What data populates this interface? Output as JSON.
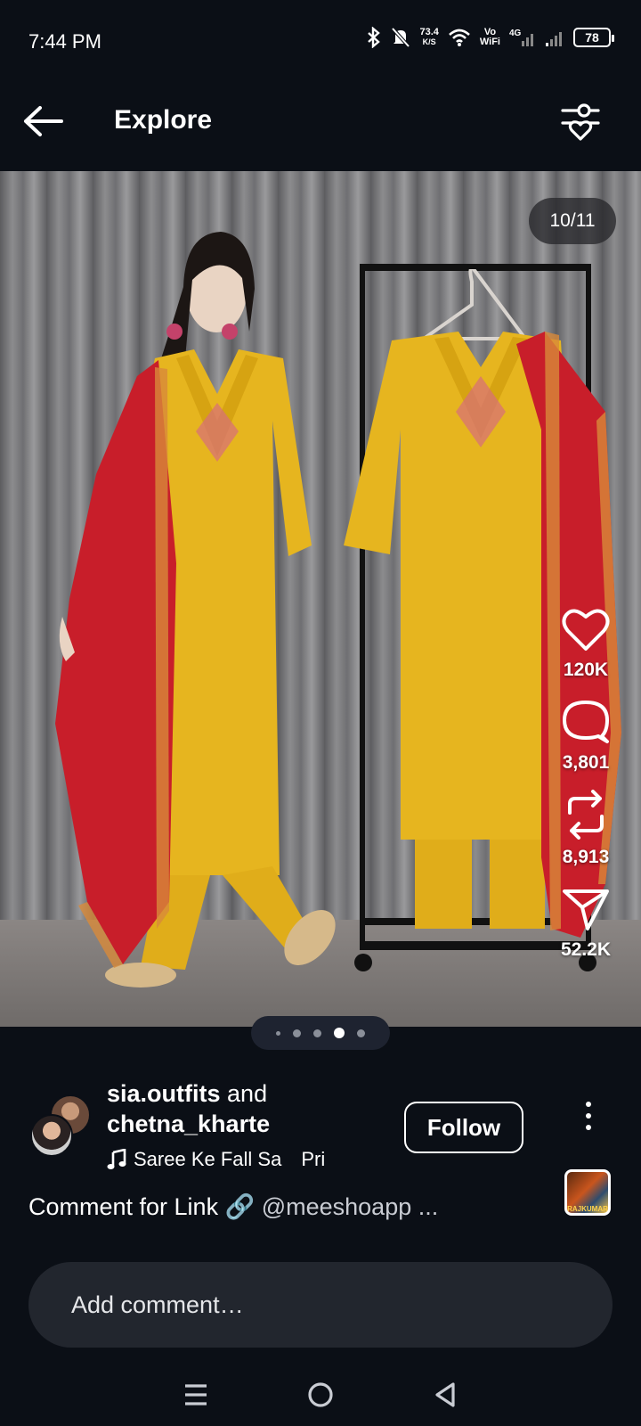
{
  "status_bar": {
    "time": "7:44 PM",
    "net_speed_value": "73.4",
    "net_speed_unit": "K/S",
    "vowifi_top": "Vo",
    "vowifi_bottom": "WiFi",
    "network": "4G",
    "battery": "78"
  },
  "header": {
    "title": "Explore"
  },
  "media": {
    "page_counter": "10/11",
    "carousel_dots": 5,
    "carousel_active_index": 3
  },
  "actions": {
    "likes": "120K",
    "comments": "3,801",
    "reposts": "8,913",
    "shares": "52.2K"
  },
  "post": {
    "author_1": "sia.outfits",
    "and_text": "and",
    "author_2": "chetna_kharte",
    "music": "Saree Ke Fall Sa",
    "music_suffix": "Pri",
    "follow_label": "Follow",
    "caption_text": "Comment for Link 🔗",
    "caption_mention": "@meeshoapp ...",
    "audio_thumb_text": "RAJKUMAR"
  },
  "comment": {
    "placeholder": "Add comment…"
  },
  "colors": {
    "background": "#0b0f16",
    "kurta_yellow": "#e6b51f",
    "dupatta_red": "#c81e2a",
    "comment_bg": "#22262e"
  }
}
